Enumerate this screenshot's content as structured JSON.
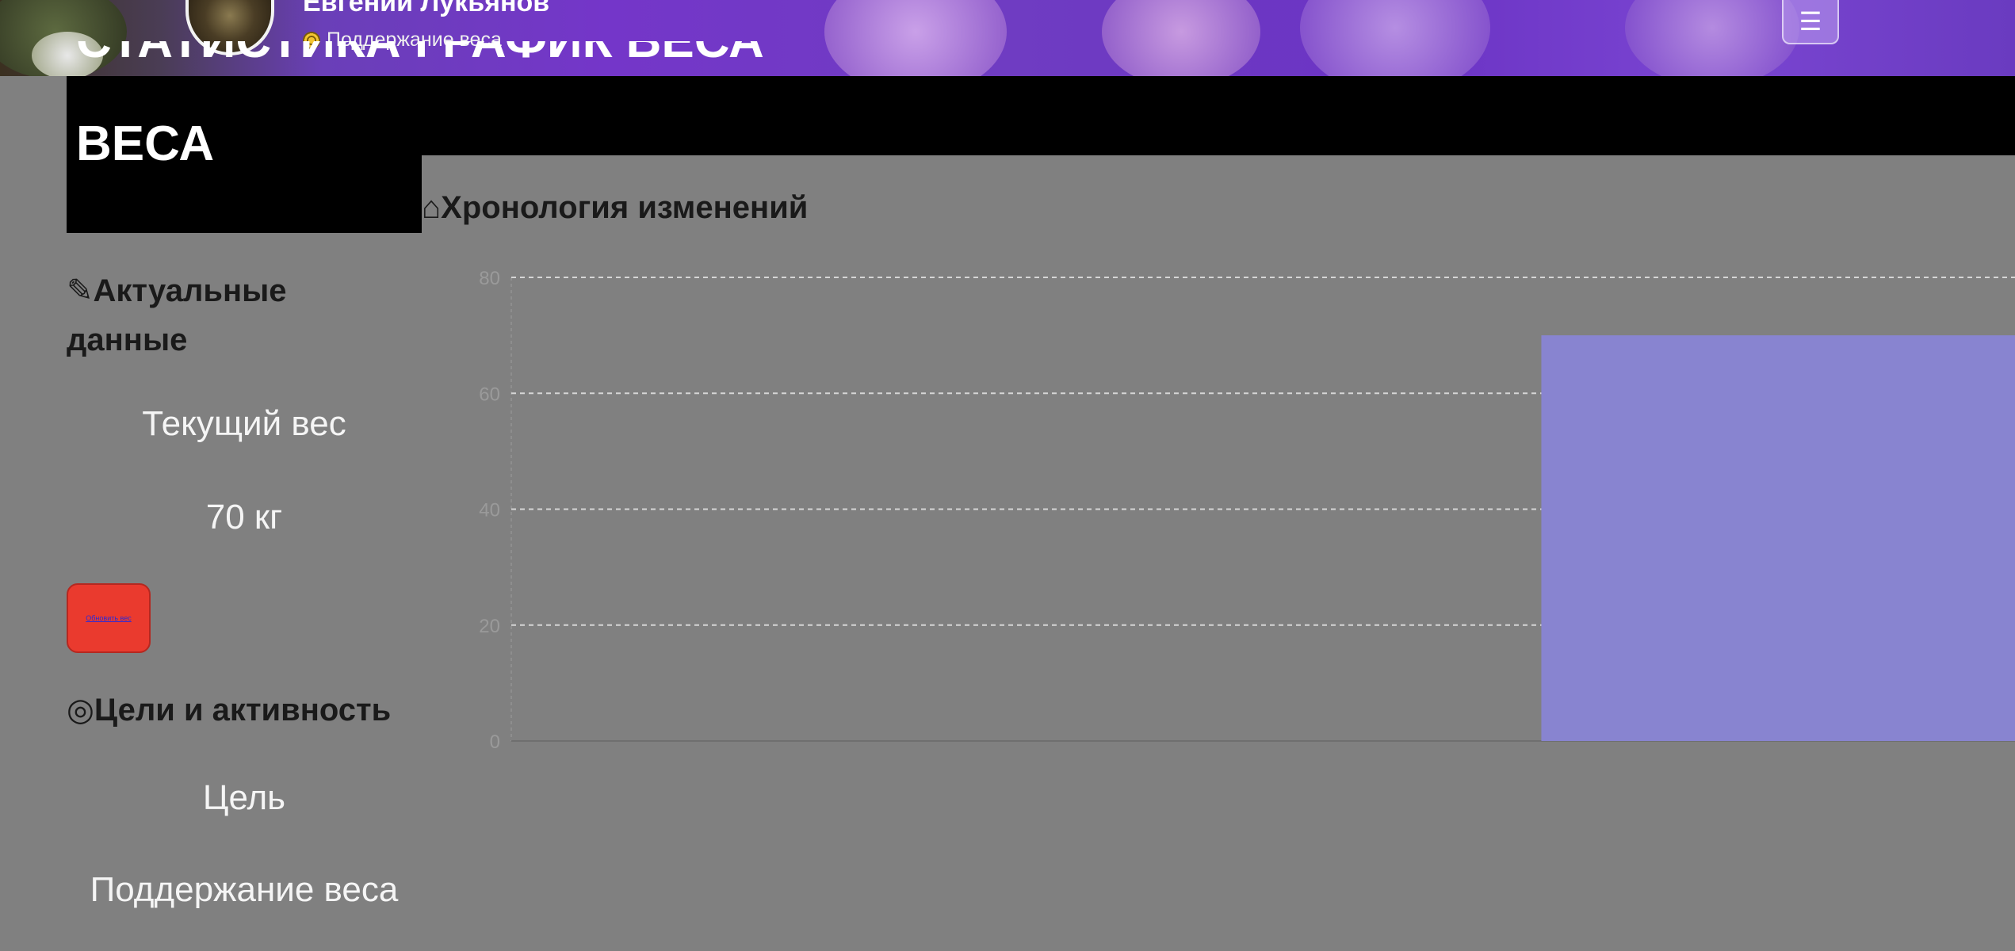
{
  "header": {
    "user_name": "Евгений Лукьянов",
    "status": "Поддержание веса",
    "status_icon": "target-icon",
    "menu_icon": "☰",
    "avatar_icon": "avatar"
  },
  "page_title": {
    "line1": "СТАТИСТИКА ГРАФИК ВЕСА",
    "line2": "ВЕСА"
  },
  "current_data": {
    "heading": "✎Актуальные данные",
    "weight_label": "Текущий вес",
    "weight_value": "70 кг",
    "update_button_label": "Обновить вес"
  },
  "goals": {
    "heading": "◎Цели и активность",
    "goal_label": "Цель",
    "goal_value": "Поддержание веса"
  },
  "chart_section": {
    "heading": "⌂Хронология изменений"
  },
  "colors": {
    "bar": "#8884d0",
    "page_bg": "#808080",
    "button_bg": "#ea3a2e"
  },
  "chart_data": {
    "type": "bar",
    "categories": [
      "",
      ""
    ],
    "values": [
      0,
      70
    ],
    "ylim": [
      0,
      80
    ],
    "yticks": [
      "0",
      "20",
      "40",
      "60",
      "80"
    ],
    "grid": true,
    "title": "",
    "xlabel": "",
    "ylabel": ""
  }
}
